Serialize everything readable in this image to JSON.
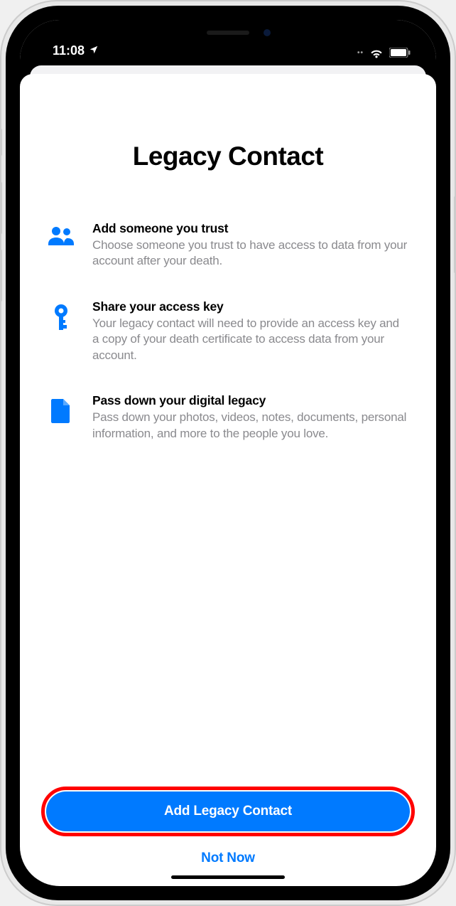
{
  "status": {
    "time": "11:08",
    "location_icon": "location-arrow-icon",
    "wifi_icon": "wifi-icon",
    "battery_icon": "battery-icon"
  },
  "page": {
    "title": "Legacy Contact"
  },
  "features": [
    {
      "icon": "people-icon",
      "title": "Add someone you trust",
      "desc": "Choose someone you trust to have access to data from your account after your death."
    },
    {
      "icon": "key-icon",
      "title": "Share your access key",
      "desc": "Your legacy contact will need to provide an access key and a copy of your death certificate to access data from your account."
    },
    {
      "icon": "document-icon",
      "title": "Pass down your digital legacy",
      "desc": "Pass down your photos, videos, notes, documents, personal information, and more to the people you love."
    }
  ],
  "buttons": {
    "primary": "Add Legacy Contact",
    "secondary": "Not Now"
  },
  "colors": {
    "accent": "#007aff",
    "highlight_ring": "#ff0000"
  }
}
